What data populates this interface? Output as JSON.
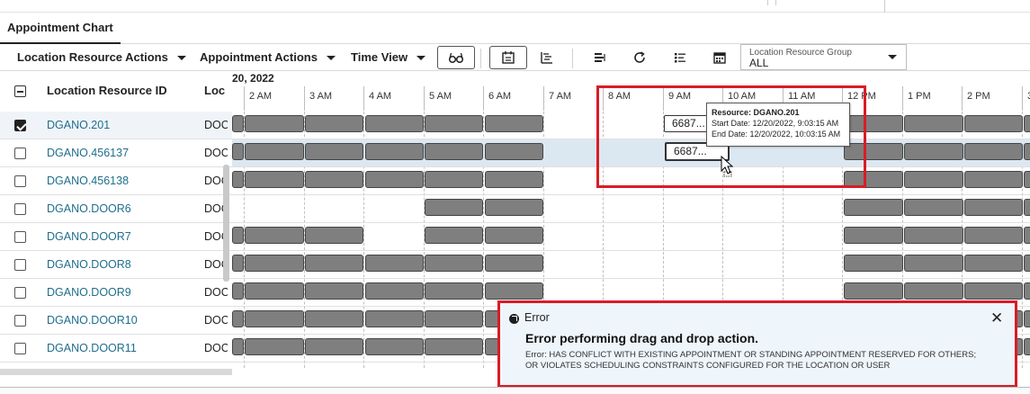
{
  "tab": {
    "label": "Appointment Chart"
  },
  "toolbar": {
    "location_actions": "Location Resource Actions",
    "appointment_actions": "Appointment Actions",
    "time_view": "Time View",
    "location_resource_group": {
      "label": "Location Resource Group",
      "value": "ALL"
    }
  },
  "grid": {
    "col_id": "Location Resource ID",
    "col_loc": "Loc",
    "rows": [
      {
        "id": "DGANO.201",
        "loc": "DOC",
        "checked": true
      },
      {
        "id": "DGANO.456137",
        "loc": "DOC",
        "checked": false
      },
      {
        "id": "DGANO.456138",
        "loc": "DOC",
        "checked": false
      },
      {
        "id": "DGANO.DOOR6",
        "loc": "DOC",
        "checked": false
      },
      {
        "id": "DGANO.DOOR7",
        "loc": "DOC",
        "checked": false
      },
      {
        "id": "DGANO.DOOR8",
        "loc": "DOC",
        "checked": false
      },
      {
        "id": "DGANO.DOOR9",
        "loc": "DOC",
        "checked": false
      },
      {
        "id": "DGANO.DOOR10",
        "loc": "DOC",
        "checked": false
      },
      {
        "id": "DGANO.DOOR11",
        "loc": "DOC",
        "checked": false
      }
    ]
  },
  "chart": {
    "date": "20, 2022",
    "hours": [
      "2 AM",
      "3 AM",
      "4 AM",
      "5 AM",
      "6 AM",
      "7 AM",
      "8 AM",
      "9 AM",
      "10 AM",
      "11 AM",
      "12 PM",
      "1 PM",
      "2 PM",
      "3"
    ],
    "appt_label_row1": "6687...",
    "appt_label_row2": "6687..."
  },
  "tooltip": {
    "resource": "Resource: DGANO.201",
    "start": "Start Date: 12/20/2022, 9:03:15 AM",
    "end": "End Date: 12/20/2022, 10:03:15 AM"
  },
  "error": {
    "title": "Error",
    "heading": "Error performing drag and drop action.",
    "message": "Error: HAS CONFLICT WITH EXISTING APPOINTMENT OR STANDING APPOINTMENT RESERVED FOR OTHERS; OR VIOLATES SCHEDULING CONSTRAINTS CONFIGURED FOR THE LOCATION OR USER",
    "close": "✕"
  },
  "colors": {
    "accent_red": "#d91c26",
    "link": "#1f6e8c",
    "bar": "#7f7f7f",
    "highlight_row": "#dbe8f1"
  },
  "icons": [
    "glasses-icon",
    "calendar-view-icon",
    "list-indent-icon",
    "align-bars-icon",
    "refresh-icon",
    "checklist-icon",
    "calendar-grid-icon",
    "close-icon",
    "error-icon",
    "drag-cursor-icon"
  ]
}
